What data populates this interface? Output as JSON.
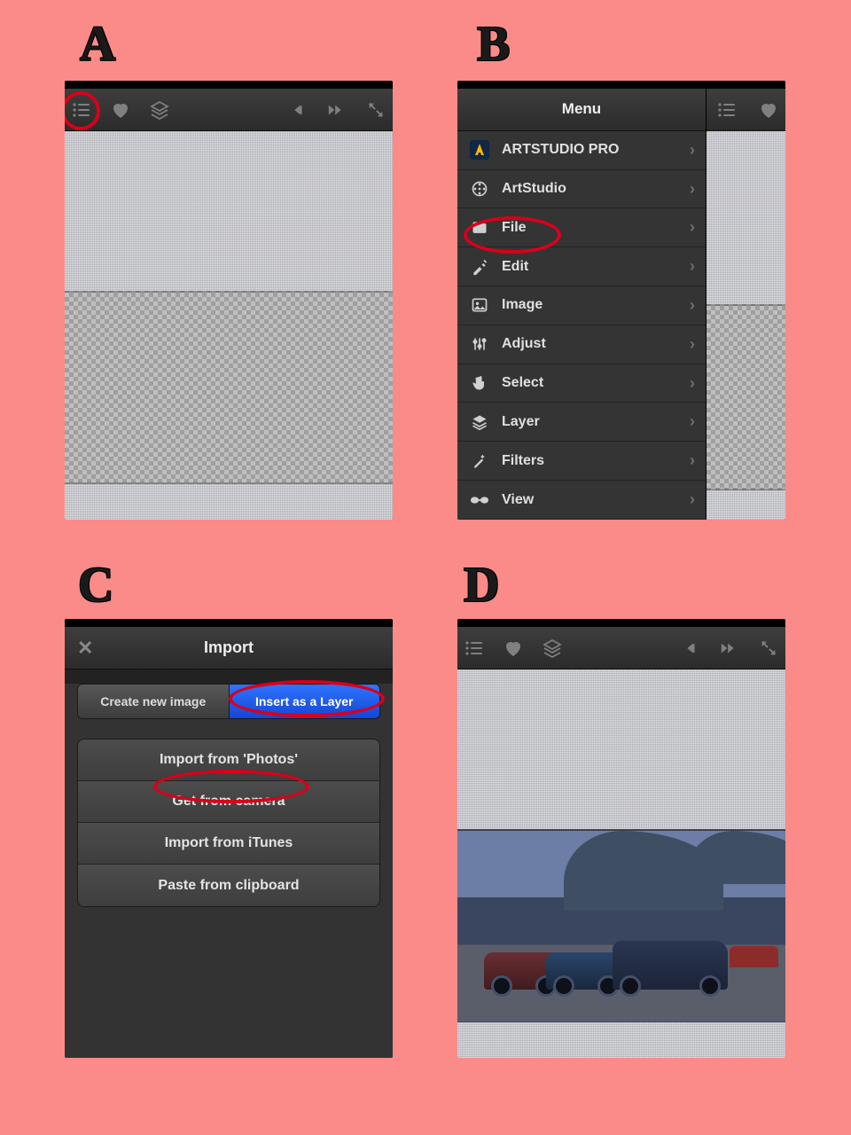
{
  "labels": {
    "a": "A",
    "b": "B",
    "c": "C",
    "d": "D"
  },
  "panelA": {},
  "panelB": {
    "menu_title": "Menu",
    "items": [
      {
        "label": "ARTSTUDIO PRO",
        "icon": "app-logo-icon"
      },
      {
        "label": "ArtStudio",
        "icon": "film-reel-icon"
      },
      {
        "label": "File",
        "icon": "folder-icon"
      },
      {
        "label": "Edit",
        "icon": "tools-icon"
      },
      {
        "label": "Image",
        "icon": "picture-icon"
      },
      {
        "label": "Adjust",
        "icon": "sliders-icon"
      },
      {
        "label": "Select",
        "icon": "hand-icon"
      },
      {
        "label": "Layer",
        "icon": "layers-icon"
      },
      {
        "label": "Filters",
        "icon": "wand-icon"
      },
      {
        "label": "View",
        "icon": "glasses-icon"
      }
    ]
  },
  "panelC": {
    "title": "Import",
    "segments": [
      "Create new image",
      "Insert as a Layer"
    ],
    "selected_segment": 1,
    "rows": [
      "Import from 'Photos'",
      "Get from camera",
      "Import from iTunes",
      "Paste from clipboard"
    ]
  }
}
